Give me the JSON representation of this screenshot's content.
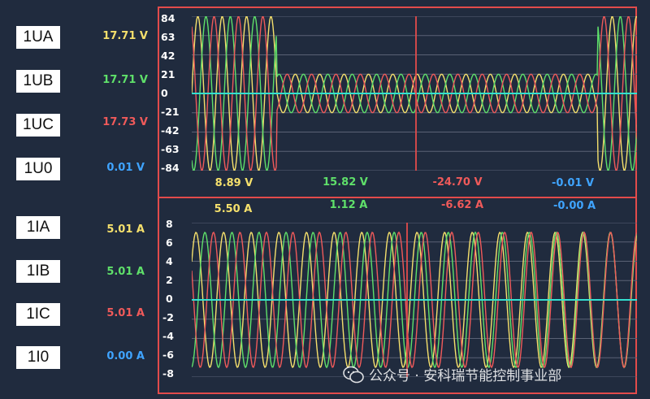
{
  "channels": [
    {
      "label": "1UA",
      "value": "17.71  V",
      "color": "#f5e06c"
    },
    {
      "label": "1UB",
      "value": "17.71  V",
      "color": "#5fe06a"
    },
    {
      "label": "1UC",
      "value": "17.73  V",
      "color": "#f05a5a"
    },
    {
      "label": "1U0",
      "value": "0.01 V",
      "color": "#3fa4ff"
    },
    {
      "label": "1IA",
      "value": "5.01  A",
      "color": "#f5e06c"
    },
    {
      "label": "1IB",
      "value": "5.01  A",
      "color": "#5fe06a"
    },
    {
      "label": "1IC",
      "value": "5.01  A",
      "color": "#f05a5a"
    },
    {
      "label": "1I0",
      "value": "0.00 A",
      "color": "#3fa4ff"
    }
  ],
  "voltage_axis": {
    "ticks": [
      "84",
      "63",
      "42",
      "21",
      "0",
      "-21",
      "-42",
      "-63",
      "-84"
    ]
  },
  "current_axis": {
    "ticks": [
      "8",
      "6",
      "4",
      "2",
      "0",
      "-2",
      "-4",
      "-6",
      "-8"
    ]
  },
  "cursor_voltages": [
    "8.89 V",
    "15.82 V",
    "-24.70 V",
    "-0.01 V"
  ],
  "cursor_currents": [
    "5.50 A",
    "1.12 A",
    "-6.62 A",
    "-0.00 A"
  ],
  "watermark": "公众号 · 安科瑞节能控制事业部",
  "colors": {
    "phase_a": "#f5e06c",
    "phase_b": "#5fe06a",
    "phase_c": "#f05a5a",
    "zero": "#3fa4ff",
    "baseline": "#33e0d0",
    "frame": "#e24b4b"
  },
  "chart_data": [
    {
      "type": "line",
      "title": "",
      "ylabel": "",
      "ylim": [
        -84,
        84
      ],
      "series": [
        {
          "name": "1UA",
          "amplitude_pre": 84,
          "amplitude_mid": 21
        },
        {
          "name": "1UB",
          "amplitude_pre": 84,
          "amplitude_mid": 21
        },
        {
          "name": "1UC",
          "amplitude_pre": 84,
          "amplitude_mid": 21
        }
      ]
    },
    {
      "type": "line",
      "title": "",
      "ylabel": "",
      "ylim": [
        -8,
        8
      ],
      "series": [
        {
          "name": "1IA",
          "amplitude": 7
        },
        {
          "name": "1IB",
          "amplitude": 7
        },
        {
          "name": "1IC",
          "amplitude": 7
        }
      ]
    }
  ]
}
